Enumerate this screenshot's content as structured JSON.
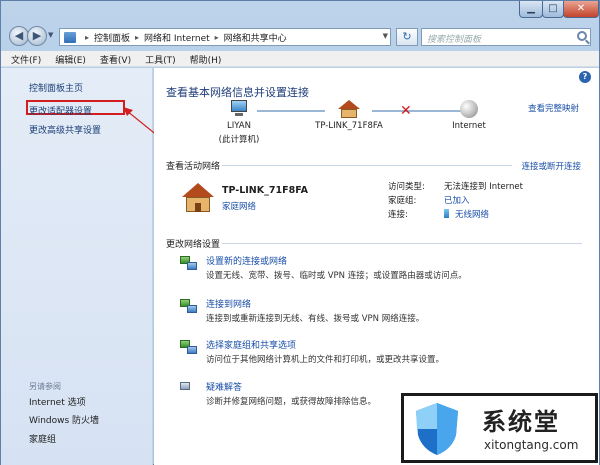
{
  "address_bar": {
    "crumbs": [
      "控制面板",
      "网络和 Internet",
      "网络和共享中心"
    ],
    "search_placeholder": "搜索控制面板"
  },
  "menu": [
    "文件(F)",
    "编辑(E)",
    "查看(V)",
    "工具(T)",
    "帮助(H)"
  ],
  "sidebar": {
    "home": "控制面板主页",
    "adapter_settings": "更改适配器设置",
    "advanced_sharing": "更改高级共享设置",
    "see_also": "另请参阅",
    "see_also_items": [
      "Internet 选项",
      "Windows 防火墙",
      "家庭组"
    ]
  },
  "main": {
    "title": "查看基本网络信息并设置连接",
    "full_map_link": "查看完整映射",
    "map_nodes": [
      {
        "name": "LIYAN",
        "sub": "(此计算机)"
      },
      {
        "name": "TP-LINK_71F8FA",
        "sub": ""
      },
      {
        "name": "Internet",
        "sub": ""
      }
    ],
    "active_networks_header": "查看活动网络",
    "connect_disconnect_link": "连接或断开连接",
    "network": {
      "name": "TP-LINK_71F8FA",
      "type": "家庭网络",
      "props": [
        {
          "label": "访问类型:",
          "value": "无法连接到 Internet"
        },
        {
          "label": "家庭组:",
          "value": "已加入"
        },
        {
          "label": "连接:",
          "value": "无线网络"
        }
      ]
    },
    "change_settings_header": "更改网络设置",
    "tasks": [
      {
        "link": "设置新的连接或网络",
        "desc": "设置无线、宽带、拨号、临时或 VPN 连接；或设置路由器或访问点。"
      },
      {
        "link": "连接到网络",
        "desc": "连接到或重新连接到无线、有线、拨号或 VPN 网络连接。"
      },
      {
        "link": "选择家庭组和共享选项",
        "desc": "访问位于其他网络计算机上的文件和打印机，或更改共享设置。"
      },
      {
        "link": "疑难解答",
        "desc": "诊断并修复网络问题，或获得故障排除信息。"
      }
    ]
  },
  "watermark": {
    "cn": "系统堂",
    "en": "xitongtang.com"
  },
  "colors": {
    "link": "#1a4fa8",
    "highlight_box": "#d21e1e",
    "title": "#1f3c7a"
  }
}
